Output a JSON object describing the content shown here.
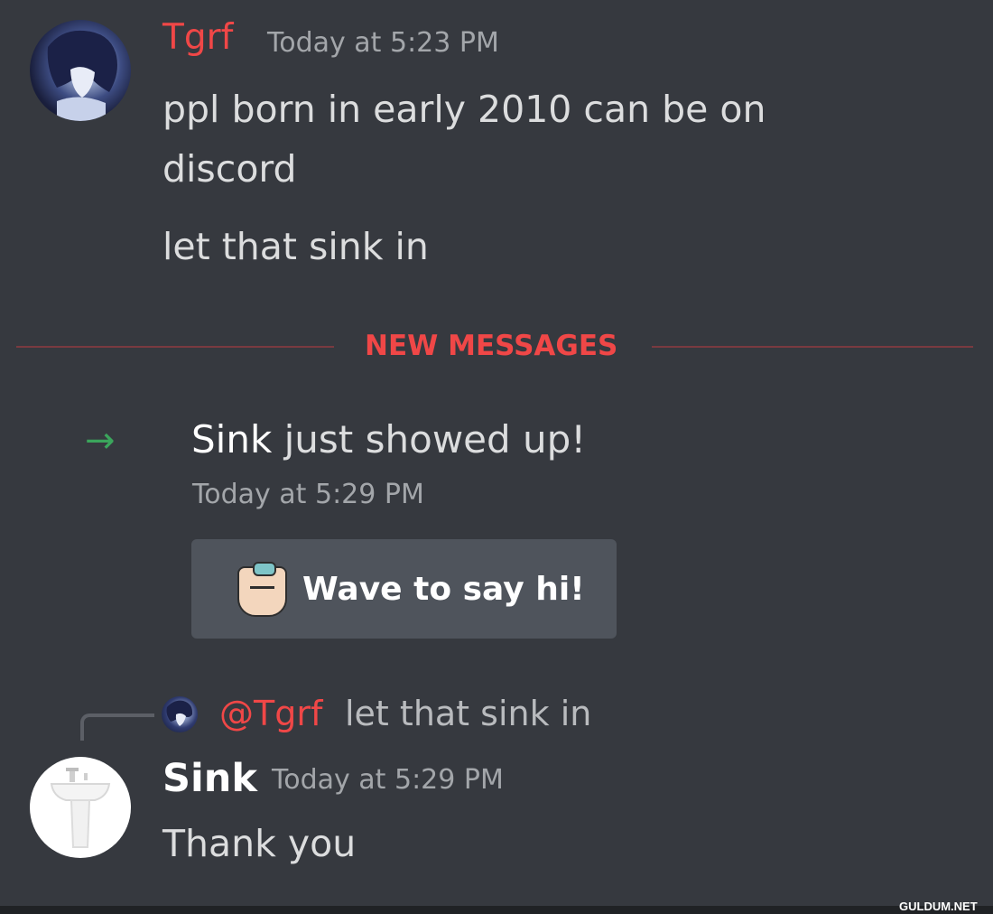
{
  "messages": [
    {
      "author": "Tgrf",
      "timestamp": "Today at 5:23 PM",
      "lines": [
        "ppl born in early 2010 can be on",
        "discord",
        "let that sink in"
      ]
    }
  ],
  "divider": {
    "label": "NEW MESSAGES"
  },
  "join_event": {
    "name": "Sink",
    "text": " just showed up!",
    "timestamp": "Today at 5:29 PM",
    "wave_button_label": "Wave to say hi!"
  },
  "reply": {
    "mention": "@Tgrf",
    "text": "let that sink in",
    "author": "Sink",
    "timestamp": "Today at 5:29 PM",
    "message": "Thank you"
  },
  "watermark": "GULDUM.NET",
  "colors": {
    "background": "#36393f",
    "mention_red": "#f04747",
    "join_arrow_green": "#3ba55c",
    "button_bg": "#4f545c"
  },
  "icons": {
    "join": "arrow-right-icon",
    "wave": "wave-emoji-icon"
  }
}
